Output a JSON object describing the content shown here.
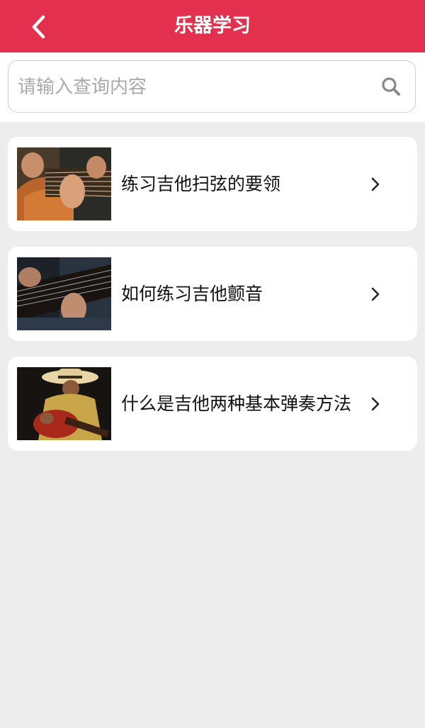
{
  "header": {
    "title": "乐器学习",
    "back_icon": "chevron-left-icon",
    "color": "#e2304e"
  },
  "search": {
    "placeholder": "请输入查询内容",
    "value": "",
    "icon": "search-icon"
  },
  "articles": [
    {
      "title": "练习吉他扫弦的要领",
      "image": "guitar-strumming-photo",
      "arrow_icon": "chevron-right-icon"
    },
    {
      "title": "如何练习吉他颤音",
      "image": "guitar-vibrato-photo",
      "arrow_icon": "chevron-right-icon"
    },
    {
      "title": "什么是吉他两种基本弹奏方法",
      "image": "guitar-player-hat-photo",
      "arrow_icon": "chevron-right-icon"
    }
  ]
}
